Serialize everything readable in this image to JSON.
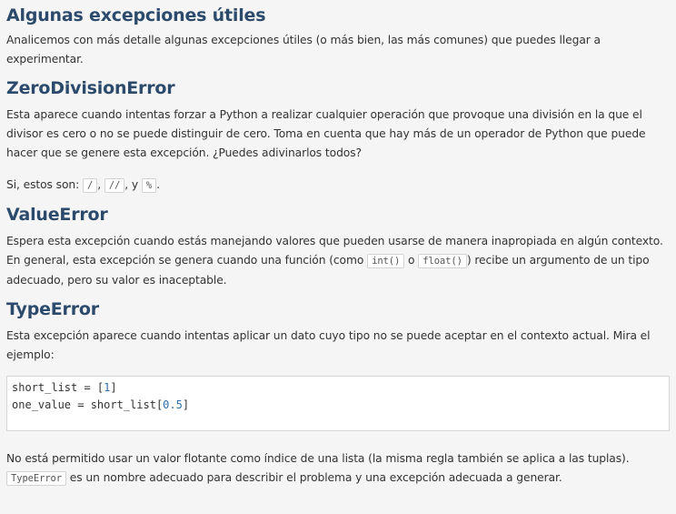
{
  "sections": {
    "intro": {
      "title": "Algunas excepciones útiles",
      "text": "Analicemos con más detalle algunas excepciones útiles (o más bien, las más comunes) que puedes llegar a experimentar."
    },
    "zero_division": {
      "title": "ZeroDivisionError",
      "text": "Esta aparece cuando intentas forzar a Python a realizar cualquier operación que provoque una división en la que el divisor es cero o no se puede distinguir de cero. Toma en cuenta que hay más de un operador de Python que puede hacer que se genere esta excepción. ¿Puedes adivinarlos todos?",
      "answer_prefix": "Si, estos son: ",
      "op1": "/",
      "sep1": ", ",
      "op2": "//",
      "sep2": ", y ",
      "op3": "%",
      "end": "."
    },
    "value_error": {
      "title": "ValueError",
      "text_before": "Espera esta excepción cuando estás manejando valores que pueden usarse de manera inapropiada en algún contexto. En general, esta excepción se genera cuando una función (como ",
      "code1": "int()",
      "text_mid": " o ",
      "code2": "float()",
      "text_after": ") recibe un argumento de un tipo adecuado, pero su valor es inaceptable."
    },
    "type_error": {
      "title": "TypeError",
      "text": "Esta excepción aparece cuando intentas aplicar un dato cuyo tipo no se puede aceptar en el contexto actual. Mira el ejemplo:",
      "code_line1_a": "short_list = [",
      "code_line1_num": "1",
      "code_line1_b": "]",
      "code_line2_a": "one_value = short_list[",
      "code_line2_num": "0.5",
      "code_line2_b": "]",
      "after_text": "No está permitido usar un valor flotante como índice de una lista (la misma regla también se aplica a las tuplas).",
      "after_code": "TypeError",
      "after_text2": " es un nombre adecuado para describir el problema y una excepción adecuada a generar."
    }
  }
}
